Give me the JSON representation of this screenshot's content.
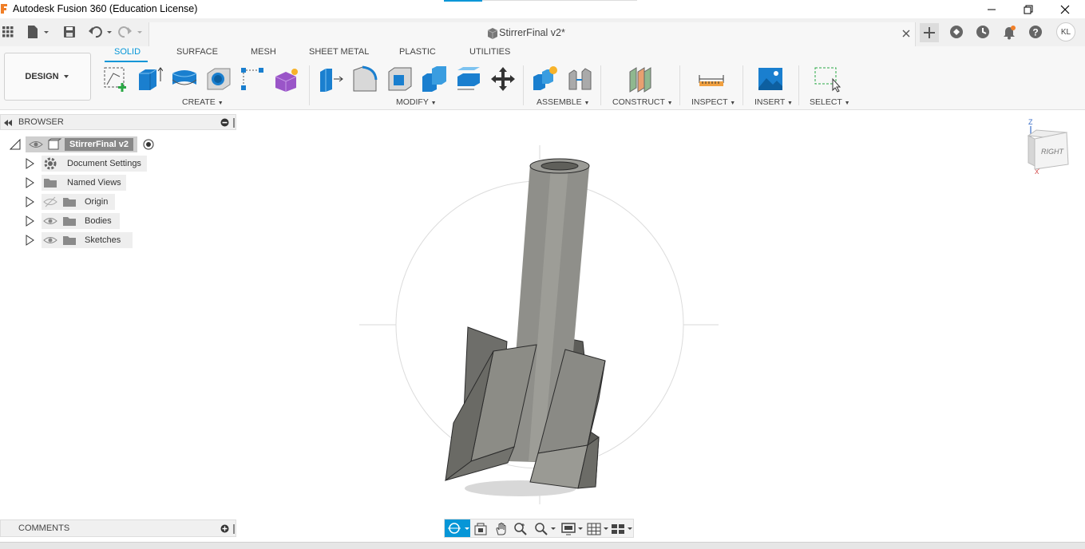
{
  "window": {
    "title": "Autodesk Fusion 360 (Education License)",
    "minimize_icon": "minimize-icon",
    "maximize_icon": "restore-icon",
    "close_icon": "close-icon"
  },
  "document": {
    "title": "StirrerFinal v2*"
  },
  "design_button": {
    "label": "DESIGN",
    "icon": "chevron-down-icon"
  },
  "workspace_tabs": [
    {
      "label": "SOLID",
      "active": true
    },
    {
      "label": "SURFACE",
      "active": false
    },
    {
      "label": "MESH",
      "active": false
    },
    {
      "label": "SHEET METAL",
      "active": false
    },
    {
      "label": "PLASTIC",
      "active": false
    },
    {
      "label": "UTILITIES",
      "active": false
    }
  ],
  "tool_groups": [
    {
      "label": "CREATE",
      "tools": [
        "create-sketch-icon",
        "extrude-icon",
        "revolve-icon",
        "hole-icon",
        "pattern-icon",
        "create-form-icon"
      ]
    },
    {
      "label": "MODIFY",
      "tools": [
        "press-pull-icon",
        "fillet-icon",
        "shell-icon",
        "combine-icon",
        "offset-face-icon",
        "move-icon"
      ]
    },
    {
      "label": "ASSEMBLE",
      "tools": [
        "new-component-icon",
        "joint-icon"
      ]
    },
    {
      "label": "CONSTRUCT",
      "tools": [
        "offset-plane-icon"
      ]
    },
    {
      "label": "INSPECT",
      "tools": [
        "measure-icon"
      ]
    },
    {
      "label": "INSERT",
      "tools": [
        "insert-image-icon"
      ]
    },
    {
      "label": "SELECT",
      "tools": [
        "window-select-icon"
      ]
    }
  ],
  "browser": {
    "title": "BROWSER",
    "root": "StirrerFinal v2",
    "items": [
      {
        "label": "Document Settings",
        "icon": "gear-icon"
      },
      {
        "label": "Named Views",
        "icon": "folder-icon"
      },
      {
        "label": "Origin",
        "icon": "folder-icon",
        "visibility": "hidden"
      },
      {
        "label": "Bodies",
        "icon": "folder-icon",
        "visibility": "visible"
      },
      {
        "label": "Sketches",
        "icon": "folder-icon",
        "visibility": "visible"
      }
    ]
  },
  "comments": {
    "label": "COMMENTS"
  },
  "viewcube": {
    "face_label": "RIGHT",
    "axis_z": "Z",
    "axis_x": "X"
  },
  "colors": {
    "accent": "#0696d7",
    "toolbar_bg": "#f7f7f7",
    "model_gray": "#8a8a84"
  },
  "user_initials": "KL"
}
